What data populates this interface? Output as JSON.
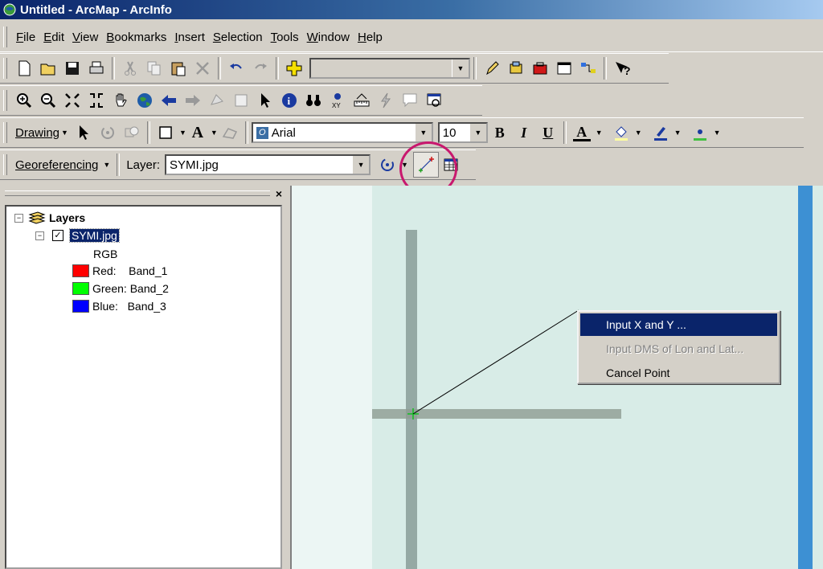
{
  "window": {
    "title": "Untitled - ArcMap - ArcInfo"
  },
  "menu": [
    {
      "label": "File",
      "key": "F"
    },
    {
      "label": "Edit",
      "key": "E"
    },
    {
      "label": "View",
      "key": "V"
    },
    {
      "label": "Bookmarks",
      "key": "B"
    },
    {
      "label": "Insert",
      "key": "I"
    },
    {
      "label": "Selection",
      "key": "S"
    },
    {
      "label": "Tools",
      "key": "T"
    },
    {
      "label": "Window",
      "key": "W"
    },
    {
      "label": "Help",
      "key": "H"
    }
  ],
  "drawing_toolbar": {
    "drawing_label": "Drawing",
    "font_name": "Arial",
    "font_size": "10",
    "bold": "B",
    "italic": "I",
    "underline": "U",
    "text_a": "A",
    "font_color_a": "A"
  },
  "georef_toolbar": {
    "georef_label": "Georeferencing",
    "layer_label": "Layer:",
    "layer_value": "SYMI.jpg"
  },
  "toc": {
    "root": "Layers",
    "layer": "SYMI.jpg",
    "rgb": "RGB",
    "bands": [
      {
        "label": "Red:    Band_1",
        "color": "#ff0000"
      },
      {
        "label": "Green: Band_2",
        "color": "#00ff00"
      },
      {
        "label": "Blue:   Band_3",
        "color": "#0000ff"
      }
    ]
  },
  "context_menu": {
    "items": [
      {
        "label": "Input X and Y ...",
        "state": "highlighted"
      },
      {
        "label": "Input DMS of Lon and Lat...",
        "state": "disabled"
      },
      {
        "label": "Cancel Point",
        "state": "normal"
      }
    ]
  },
  "colors": {
    "title_gradient_start": "#0a246a",
    "highlight": "#0a246a",
    "annotation_circle": "#c8186e"
  }
}
